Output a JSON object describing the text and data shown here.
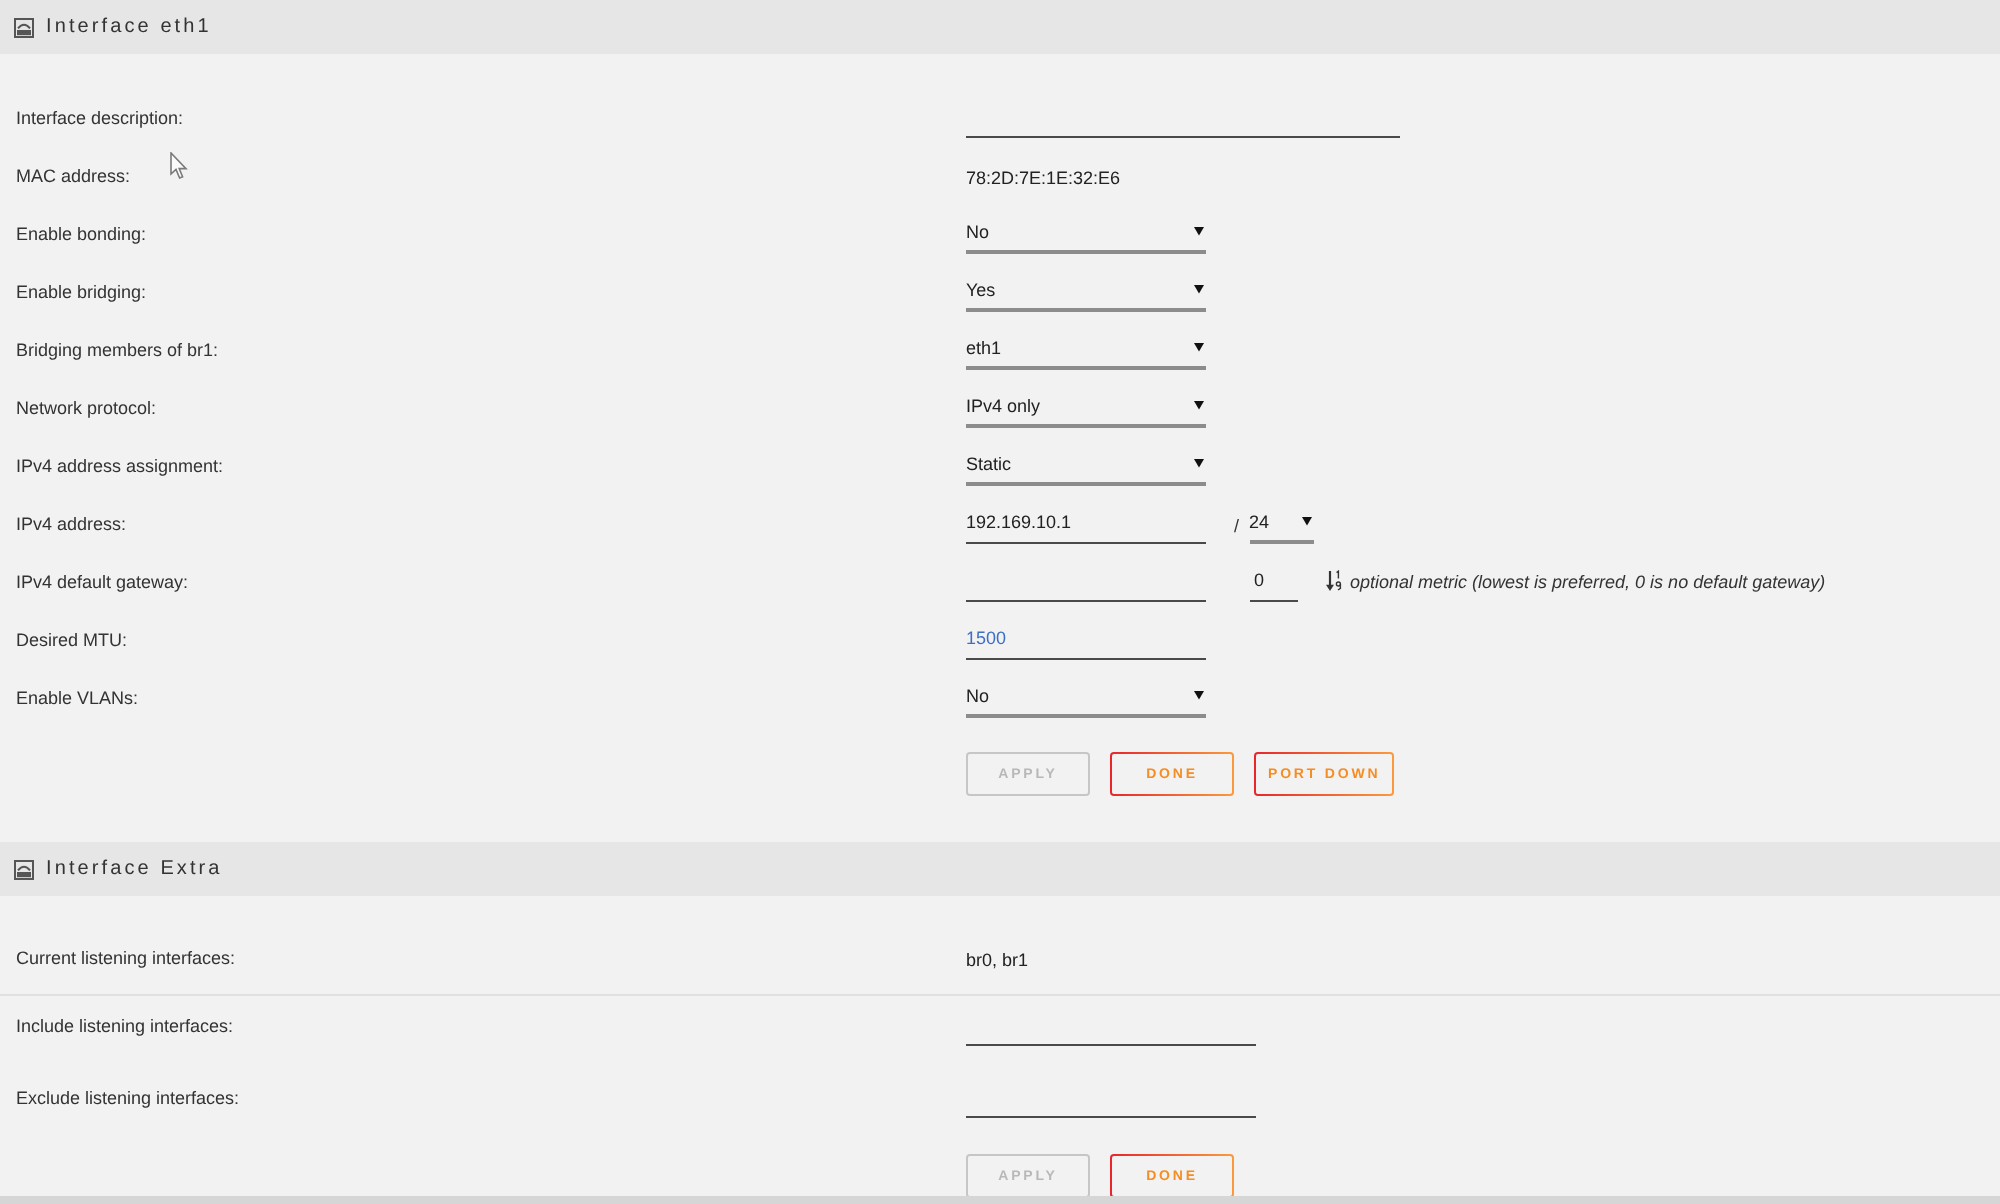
{
  "sections": [
    {
      "title": "Interface eth1",
      "rows": [
        {
          "label": "Interface description:",
          "controls": [
            {
              "kind": "wide"
            }
          ]
        },
        {
          "label": "MAC address:",
          "controls": [
            {
              "kind": "text",
              "value": "78:2D:7E:1E:32:E6"
            }
          ]
        },
        {
          "label": "Enable bonding:",
          "controls": [
            {
              "kind": "select",
              "value": "No"
            }
          ]
        },
        {
          "label": "Enable bridging:",
          "controls": [
            {
              "kind": "select",
              "value": "Yes"
            }
          ]
        },
        {
          "label": "Bridging members of br1:",
          "controls": [
            {
              "kind": "select",
              "value": "eth1"
            }
          ]
        },
        {
          "label": "Network protocol:",
          "controls": [
            {
              "kind": "select",
              "value": "IPv4 only"
            }
          ]
        },
        {
          "label": "IPv4 address assignment:",
          "controls": [
            {
              "kind": "select",
              "value": "Static"
            }
          ]
        },
        {
          "label": "IPv4 address:",
          "controls": [
            {
              "kind": "field",
              "value": "192.169.10.1"
            },
            {
              "kind": "slash",
              "text": "/"
            },
            {
              "kind": "prefix",
              "value": "24"
            }
          ]
        },
        {
          "label": "IPv4 default gateway:",
          "controls": [
            {
              "kind": "field"
            },
            {
              "kind": "metric",
              "value": "0"
            },
            {
              "kind": "hint",
              "text": "optional metric (lowest is preferred, 0 is no default gateway)"
            }
          ]
        },
        {
          "label": "Desired MTU:",
          "controls": [
            {
              "kind": "field",
              "placeholder": "1500"
            }
          ]
        },
        {
          "label": "Enable VLANs:",
          "controls": [
            {
              "kind": "select",
              "value": "No"
            }
          ]
        }
      ],
      "buttons": [
        {
          "label": "APPLY",
          "disabled": true
        },
        {
          "label": "DONE",
          "disabled": false
        },
        {
          "label": "PORT DOWN",
          "disabled": false
        }
      ]
    },
    {
      "title": "Interface Extra",
      "info": [
        {
          "label": "Current listening interfaces:",
          "value": "br0, br1"
        }
      ],
      "rows": [
        {
          "label": "Include listening interfaces:",
          "controls": [
            {
              "kind": "mid"
            }
          ]
        },
        {
          "label": "Exclude listening interfaces:",
          "controls": [
            {
              "kind": "mid"
            }
          ]
        }
      ],
      "buttons": [
        {
          "label": "APPLY",
          "disabled": true
        },
        {
          "label": "DONE",
          "disabled": false
        }
      ]
    }
  ]
}
